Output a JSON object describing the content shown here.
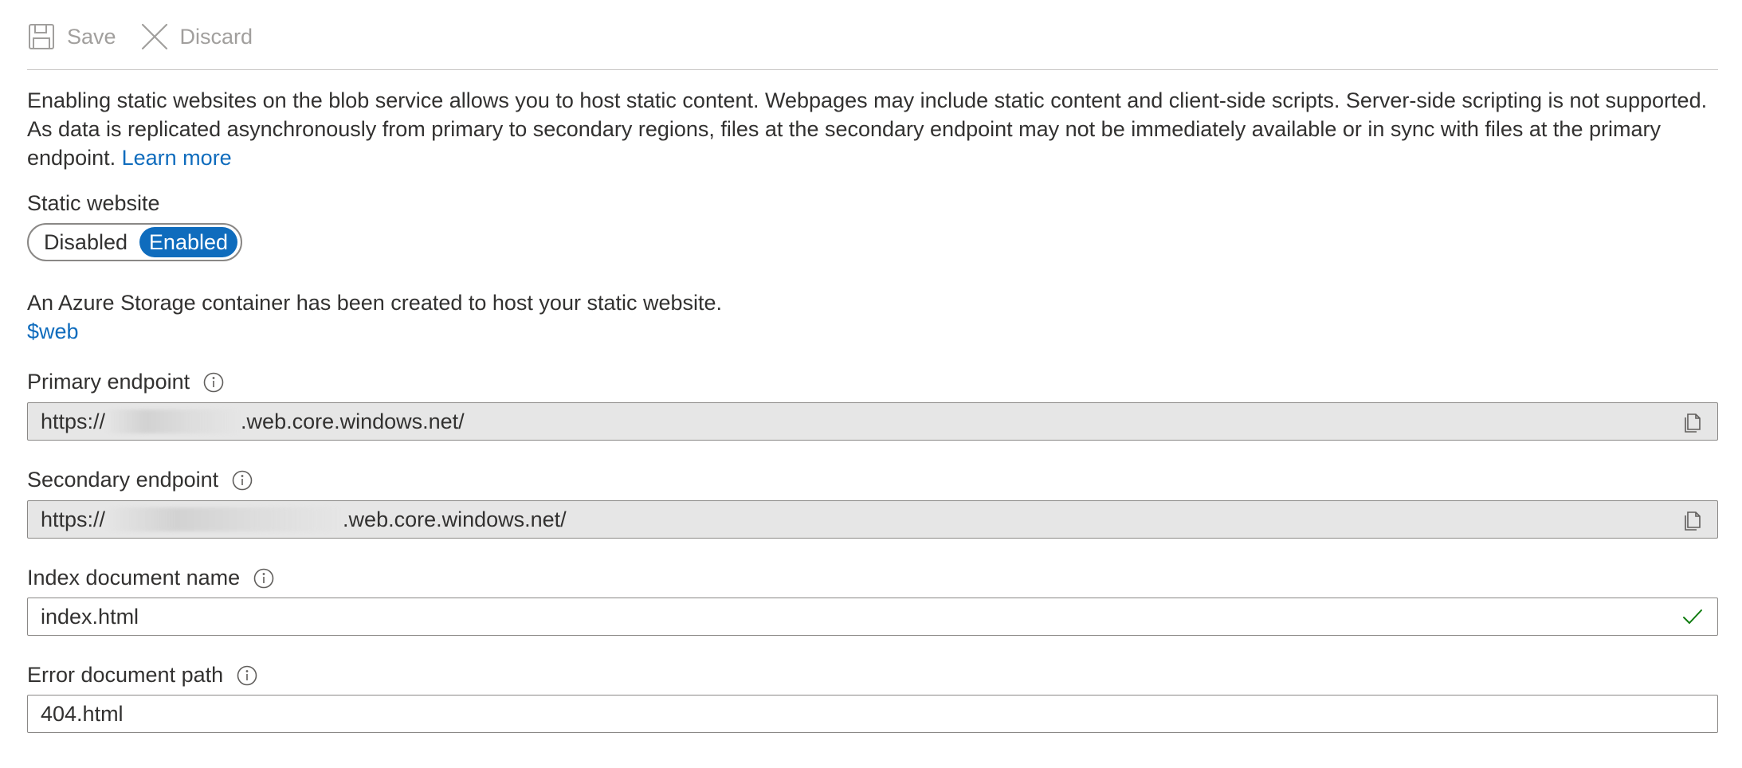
{
  "toolbar": {
    "save_label": "Save",
    "discard_label": "Discard",
    "save_icon": "save-icon",
    "discard_icon": "close-icon"
  },
  "description": {
    "text": "Enabling static websites on the blob service allows you to host static content. Webpages may include static content and client-side scripts. Server-side scripting is not supported. As data is replicated asynchronously from primary to secondary regions, files at the secondary endpoint may not be immediately available or in sync with files at the primary endpoint.",
    "learn_more": "Learn more"
  },
  "static_website": {
    "label": "Static website",
    "options": [
      "Disabled",
      "Enabled"
    ],
    "selected": "Enabled"
  },
  "container": {
    "note": "An Azure Storage container has been created to host your static website.",
    "link": "$web"
  },
  "primary_endpoint": {
    "label": "Primary endpoint",
    "prefix": "https://",
    "suffix": ".web.core.windows.net/"
  },
  "secondary_endpoint": {
    "label": "Secondary endpoint",
    "prefix": "https://",
    "suffix": ".web.core.windows.net/"
  },
  "index_document": {
    "label": "Index document name",
    "value": "index.html"
  },
  "error_document": {
    "label": "Error document path",
    "value": "404.html"
  },
  "colors": {
    "accent": "#0f6cbd",
    "valid": "#107c10",
    "disabled_text": "#a19f9d",
    "readonly_bg": "#e6e6e6"
  }
}
